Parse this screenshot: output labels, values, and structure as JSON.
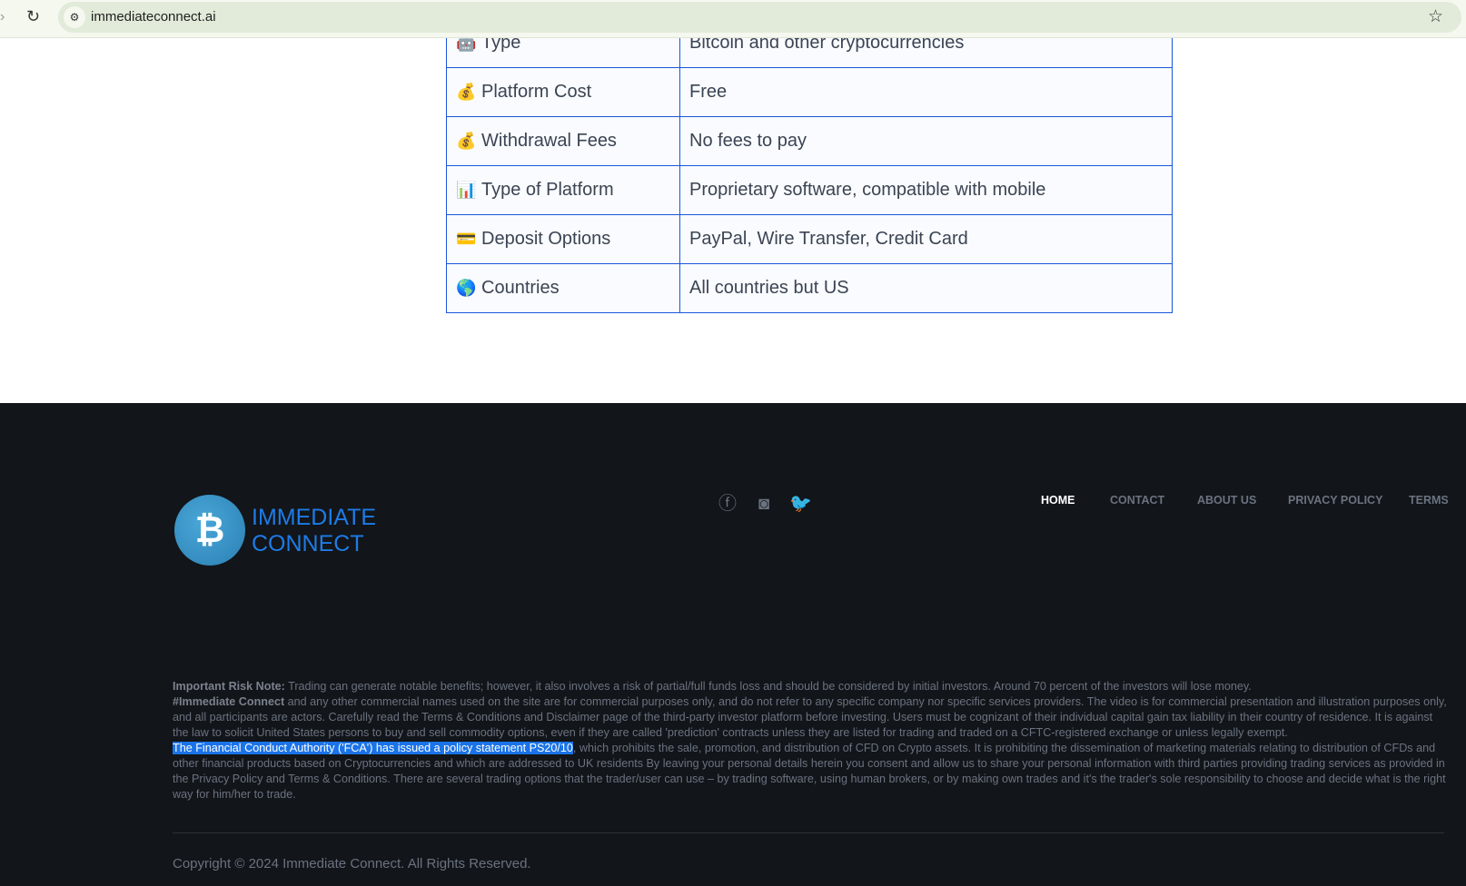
{
  "browser": {
    "url": "immediateconnect.ai"
  },
  "table": [
    {
      "icon": "🤖",
      "label": "Type",
      "value": "Bitcoin and other cryptocurrencies"
    },
    {
      "icon": "💰",
      "label": "Platform Cost",
      "value": "Free"
    },
    {
      "icon": "💰",
      "label": "Withdrawal Fees",
      "value": "No fees to pay"
    },
    {
      "icon": "📊",
      "label": "Type of Platform",
      "value": "Proprietary software, compatible with mobile"
    },
    {
      "icon": "💳",
      "label": "Deposit Options",
      "value": "PayPal, Wire Transfer, Credit Card"
    },
    {
      "icon": "🌎",
      "label": "Countries",
      "value": "All countries but US"
    }
  ],
  "footer": {
    "brand_line1": "IMMEDIATE",
    "brand_line2": "CONNECT",
    "logo_symbol": "₿",
    "nav": [
      "HOME",
      "CONTACT",
      "ABOUT US",
      "PRIVACY POLICY",
      "TERMS"
    ],
    "risk_label": "Important Risk Note:",
    "risk_text": " Trading can generate notable benefits; however, it also involves a risk of partial/full funds loss and should be considered by initial investors. Around 70 percent of the investors will lose money.",
    "brand_tag": "#Immediate Connect",
    "para1": " and any other commercial names used on the site are for commercial purposes only, and do not refer to any specific company nor specific services providers. The video is for commercial presentation and illustration purposes only, and all participants are actors. Carefully read the Terms & Conditions and Disclaimer page of the third-party investor platform before investing. Users must be cognizant of their individual capital gain tax liability in their country of residence. It is against the law to solicit United States persons to buy and sell commodity options, even if they are called 'prediction' contracts unless they are listed for trading and traded on a CFTC-registered exchange or unless legally exempt.",
    "highlight": "The Financial Conduct Authority ('FCA') has issued a policy statement PS20/10",
    "para2": ", which prohibits the sale, promotion, and distribution of CFD on Crypto assets. It is prohibiting the dissemination of marketing materials relating to distribution of CFDs and other financial products based on Cryptocurrencies and which are addressed to UK residents By leaving your personal details herein you consent and allow us to share your personal information with third parties providing trading services as provided in the Privacy Policy and Terms & Conditions. There are several trading options that the trader/user can use – by trading software, using human brokers, or by making own trades and it's the trader's sole responsibility to choose and decide what is the right way for him/her to trade.",
    "copyright": "Copyright © 2024 Immediate Connect. All Rights Reserved."
  }
}
